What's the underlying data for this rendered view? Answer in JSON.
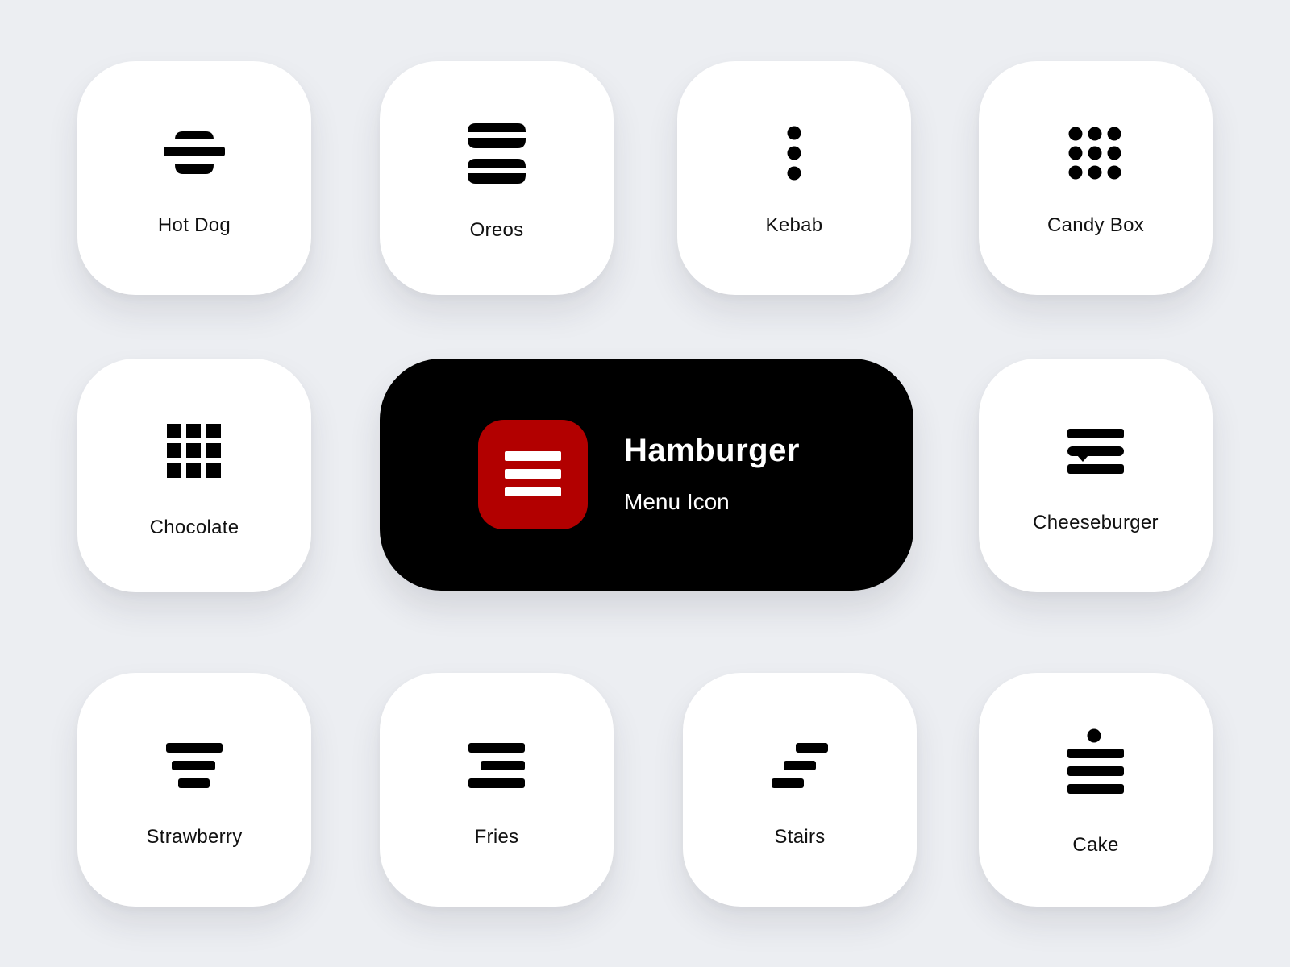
{
  "theme": {
    "background": "#eceef2",
    "card_background": "#ffffff",
    "icon_color": "#000000",
    "hero_background": "#000000",
    "hero_accent": "#b20000",
    "hero_text": "#ffffff"
  },
  "hero": {
    "icon": "hamburger-menu-icon",
    "title": "Hamburger",
    "subtitle": "Menu Icon"
  },
  "cards": [
    {
      "label": "Hot Dog",
      "icon": "hot-dog-icon"
    },
    {
      "label": "Oreos",
      "icon": "oreos-icon"
    },
    {
      "label": "Kebab",
      "icon": "kebab-icon"
    },
    {
      "label": "Candy Box",
      "icon": "candy-box-icon"
    },
    {
      "label": "Chocolate",
      "icon": "chocolate-icon"
    },
    {
      "label": "Cheeseburger",
      "icon": "cheeseburger-icon"
    },
    {
      "label": "Strawberry",
      "icon": "strawberry-icon"
    },
    {
      "label": "Fries",
      "icon": "fries-icon"
    },
    {
      "label": "Stairs",
      "icon": "stairs-icon"
    },
    {
      "label": "Cake",
      "icon": "cake-icon"
    }
  ]
}
